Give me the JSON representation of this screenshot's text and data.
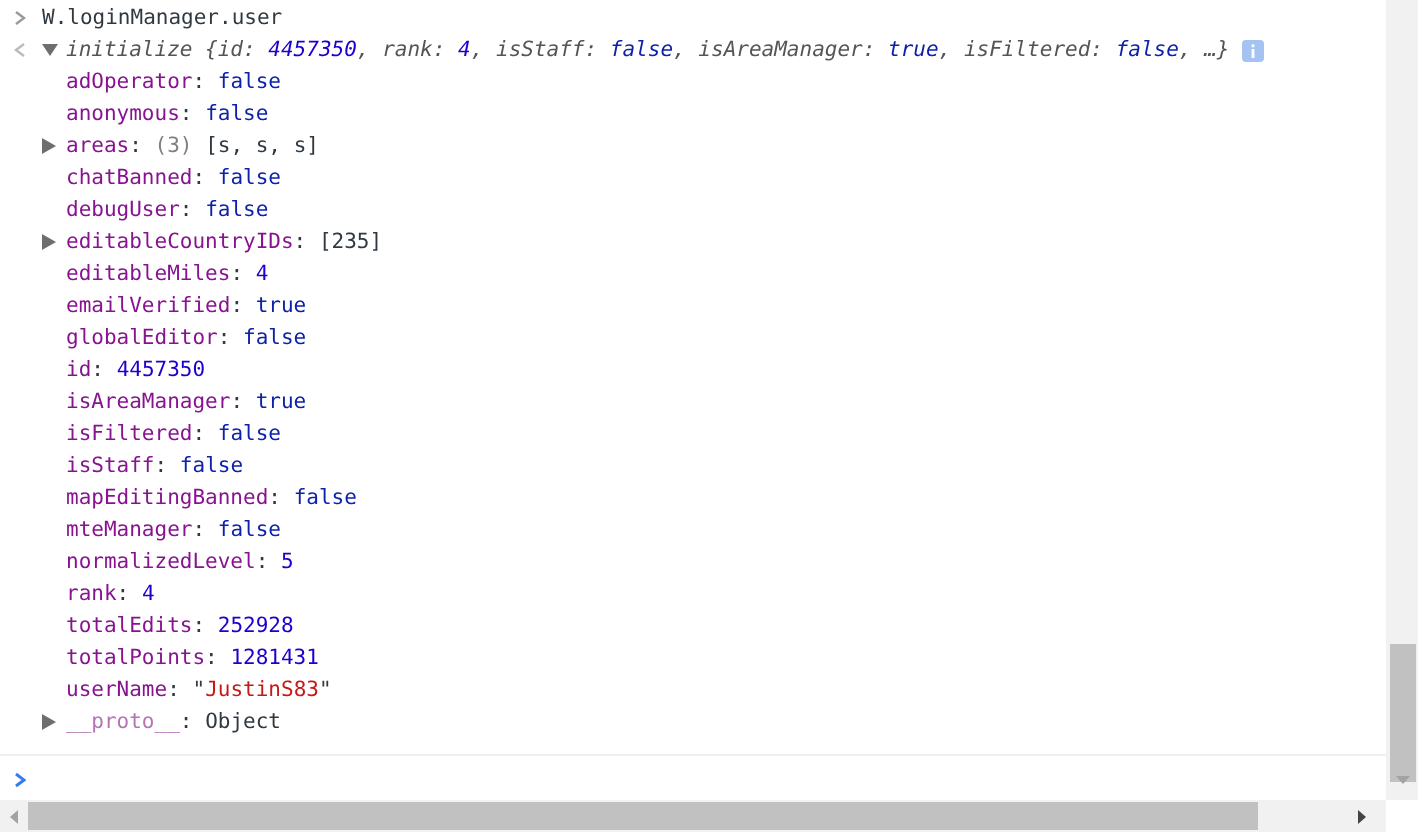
{
  "syntax": {
    "colon": ":",
    "comma": ",",
    "open": "{",
    "close": "}",
    "ellipsis": "…",
    "quote": "\""
  },
  "input": {
    "command": "W.loginManager.user"
  },
  "output": {
    "name": "initialize",
    "expanded": true,
    "summary": [
      {
        "key": "id",
        "value": "4457350",
        "kind": "number"
      },
      {
        "key": "rank",
        "value": "4",
        "kind": "number"
      },
      {
        "key": "isStaff",
        "value": "false",
        "kind": "keyword"
      },
      {
        "key": "isAreaManager",
        "value": "true",
        "kind": "keyword"
      },
      {
        "key": "isFiltered",
        "value": "false",
        "kind": "keyword"
      }
    ],
    "properties": [
      {
        "key": "adOperator",
        "value": "false",
        "kind": "keyword",
        "expandable": false
      },
      {
        "key": "anonymous",
        "value": "false",
        "kind": "keyword",
        "expandable": false
      },
      {
        "key": "areas",
        "count": "(3)",
        "value": "[s, s, s]",
        "kind": "object",
        "expandable": true
      },
      {
        "key": "chatBanned",
        "value": "false",
        "kind": "keyword",
        "expandable": false
      },
      {
        "key": "debugUser",
        "value": "false",
        "kind": "keyword",
        "expandable": false
      },
      {
        "key": "editableCountryIDs",
        "value": "[235]",
        "kind": "object",
        "expandable": true
      },
      {
        "key": "editableMiles",
        "value": "4",
        "kind": "number",
        "expandable": false
      },
      {
        "key": "emailVerified",
        "value": "true",
        "kind": "keyword",
        "expandable": false
      },
      {
        "key": "globalEditor",
        "value": "false",
        "kind": "keyword",
        "expandable": false
      },
      {
        "key": "id",
        "value": "4457350",
        "kind": "number",
        "expandable": false
      },
      {
        "key": "isAreaManager",
        "value": "true",
        "kind": "keyword",
        "expandable": false
      },
      {
        "key": "isFiltered",
        "value": "false",
        "kind": "keyword",
        "expandable": false
      },
      {
        "key": "isStaff",
        "value": "false",
        "kind": "keyword",
        "expandable": false
      },
      {
        "key": "mapEditingBanned",
        "value": "false",
        "kind": "keyword",
        "expandable": false
      },
      {
        "key": "mteManager",
        "value": "false",
        "kind": "keyword",
        "expandable": false
      },
      {
        "key": "normalizedLevel",
        "value": "5",
        "kind": "number",
        "expandable": false
      },
      {
        "key": "rank",
        "value": "4",
        "kind": "number",
        "expandable": false
      },
      {
        "key": "totalEdits",
        "value": "252928",
        "kind": "number",
        "expandable": false
      },
      {
        "key": "totalPoints",
        "value": "1281431",
        "kind": "number",
        "expandable": false
      },
      {
        "key": "userName",
        "value": "JustinS83",
        "kind": "string",
        "expandable": false
      },
      {
        "key": "__proto__",
        "value": "Object",
        "kind": "object",
        "expandable": true,
        "dim": true
      }
    ]
  }
}
